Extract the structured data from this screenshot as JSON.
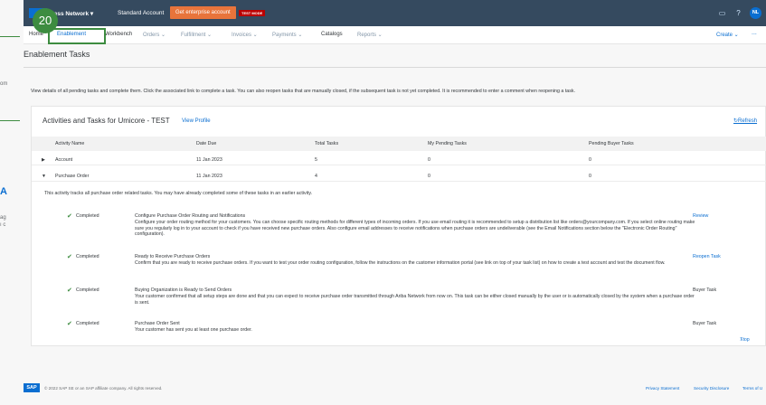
{
  "left_panel": {
    "fragment_1": "om",
    "fragment_2": "A",
    "fragment_3": "ag",
    "fragment_4": "ı c"
  },
  "step_marker": "20",
  "shell": {
    "brand": "iness Network",
    "account": "Standard Account",
    "enterprise_button": "Get enterprise account",
    "test_badge": "TEST MODE",
    "avatar_initials": "NL"
  },
  "nav": {
    "tabs": [
      "Home",
      "Enablement",
      "Workbench",
      "Orders",
      "Fulfillment",
      "Invoices",
      "Payments",
      "Catalogs",
      "Reports"
    ],
    "create_label": "Create",
    "more_label": "..."
  },
  "page": {
    "title": "Enablement Tasks",
    "description": "View details of all pending tasks and complete them. Click the associated link to complete a task. You can also reopen tasks that are manually closed, if the subsequent task is not yet completed. It is recommended to enter a comment when reopening a task."
  },
  "card": {
    "title": "Activities and Tasks for Umicore - TEST",
    "view_profile": "View Profile",
    "refresh": "Refresh",
    "columns": [
      "Activity Name",
      "Date Due",
      "Total Tasks",
      "My Pending Tasks",
      "Pending Buyer Tasks"
    ],
    "rows": [
      {
        "name": "Account",
        "date_due": "11 Jan 2023",
        "total": "5",
        "pending": "0",
        "buyer": "0"
      },
      {
        "name": "Purchase Order",
        "date_due": "11 Jan 2023",
        "total": "4",
        "pending": "0",
        "buyer": "0"
      }
    ],
    "activity_note": "This activity tracks all purchase order related tasks. You may have already completed some of these tasks in an earlier activity.",
    "tasks": [
      {
        "status": "Completed",
        "name": "Configure Purchase Order Routing and Notifications",
        "description": "Configure your order routing method for your customers. You can choose specific routing methods for different types of incoming orders. If you use email routing it is recommended to setup a distribution list like orders@yourcompany.com. If you select online routing make sure you regularly log in to your account to check if you have received new purchase orders. Also configure email addresses to receive notifications when purchase orders are undeliverable (see the Email Notifications section below the \"Electronic Order Routing\" configuration).",
        "action": "Review"
      },
      {
        "status": "Completed",
        "name": "Ready to Receive Purchase Orders",
        "description": "Confirm that you are ready to receive purchase orders. If you want to test your order routing configuration, follow the instructions on the customer information portal (see link on top of your task list) on how to create a test account and test the document flow.",
        "action": "Reopen Task"
      },
      {
        "status": "Completed",
        "name": "Buying Organization is Ready to Send Orders",
        "description": "Your customer confirmed that all setup steps are done and that you can expect to receive purchase order transmitted through Ariba Network from now on. This task can be either closed manually by the user or is automatically closed by the system when a purchase order is sent.",
        "action": "Buyer Task"
      },
      {
        "status": "Completed",
        "name": "Purchase Order Sent",
        "description": "Your customer has sent you at least one purchase order.",
        "action": "Buyer Task"
      }
    ],
    "to_top": "top"
  },
  "footer": {
    "logo": "SAP",
    "copyright": "© 2022 SAP SE or an SAP affiliate company. All rights reserved.",
    "links": [
      "Privacy Statement",
      "Security Disclosure",
      "Terms of U"
    ]
  }
}
